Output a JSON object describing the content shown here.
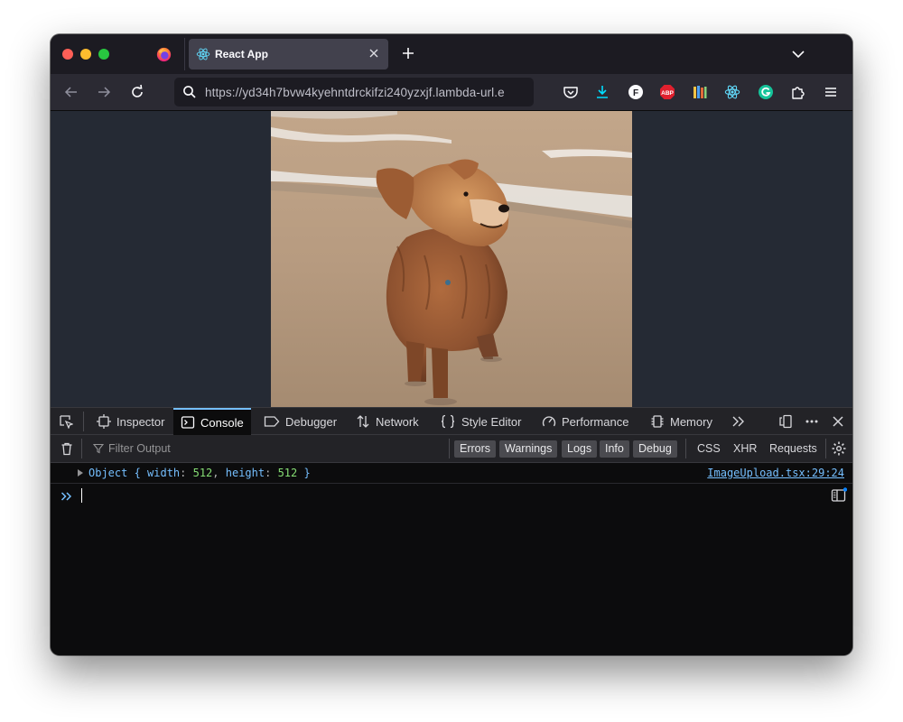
{
  "browser": {
    "tab": {
      "title": "React App"
    },
    "url": "https://yd34h7bvw4kyehntdrckifzi240yzxjf.lambda-url.e",
    "colors": {
      "accent": "#75bfff",
      "chrome": "#2b2a33",
      "tabstrip": "#1c1b22"
    },
    "extensions": [
      "pocket-icon",
      "download-icon",
      "f-extension-icon",
      "adblock-plus-icon",
      "library-icon",
      "react-devtools-icon",
      "grammarly-icon",
      "extensions-puzzle-icon",
      "menu-icon"
    ],
    "extension_labels": {
      "f": "F",
      "abp": "ABP"
    }
  },
  "page": {
    "image_subject": "golden retriever on beach"
  },
  "devtools": {
    "tabs": [
      "Inspector",
      "Console",
      "Debugger",
      "Network",
      "Style Editor",
      "Performance",
      "Memory"
    ],
    "selected_tab": "Console",
    "filter_placeholder": "Filter Output",
    "filters": [
      "Errors",
      "Warnings",
      "Logs",
      "Info",
      "Debug"
    ],
    "net_filters": [
      "CSS",
      "XHR",
      "Requests"
    ],
    "log": {
      "prefix": "Object { ",
      "k1": "width",
      "v1": "512",
      "k2": "height",
      "v2": "512",
      "suffix": " }",
      "source": "ImageUpload.tsx:29:24"
    }
  }
}
